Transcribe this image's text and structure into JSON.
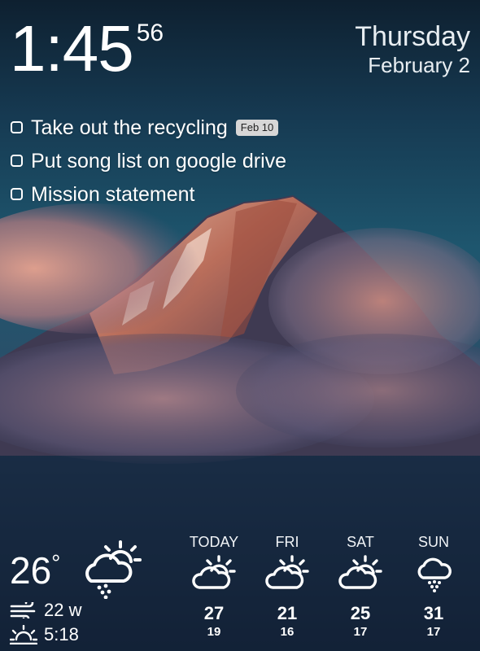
{
  "clock": {
    "time": "1:45",
    "seconds": "56"
  },
  "date": {
    "weekday": "Thursday",
    "date": "February 2"
  },
  "tasks": [
    {
      "label": "Take out the recycling",
      "badge": "Feb 10"
    },
    {
      "label": "Put song list on google drive"
    },
    {
      "label": "Mission statement"
    }
  ],
  "current_weather": {
    "temp": "26",
    "unit": "°",
    "icon": "partly-cloudy-snow-icon",
    "wind": "22 w",
    "sunrise": "5:18"
  },
  "forecast": [
    {
      "day": "TODAY",
      "icon": "partly-cloudy-icon",
      "high": "27",
      "low": "19"
    },
    {
      "day": "FRI",
      "icon": "partly-cloudy-icon",
      "high": "21",
      "low": "16"
    },
    {
      "day": "SAT",
      "icon": "partly-cloudy-icon",
      "high": "25",
      "low": "17"
    },
    {
      "day": "SUN",
      "icon": "snow-cloud-icon",
      "high": "31",
      "low": "17"
    }
  ],
  "colors": {
    "sky_top": "#0f2a40",
    "sky_mid": "#1c5068",
    "mountain_glow": "#d4836a",
    "badge_bg": "#d7d7d7"
  }
}
